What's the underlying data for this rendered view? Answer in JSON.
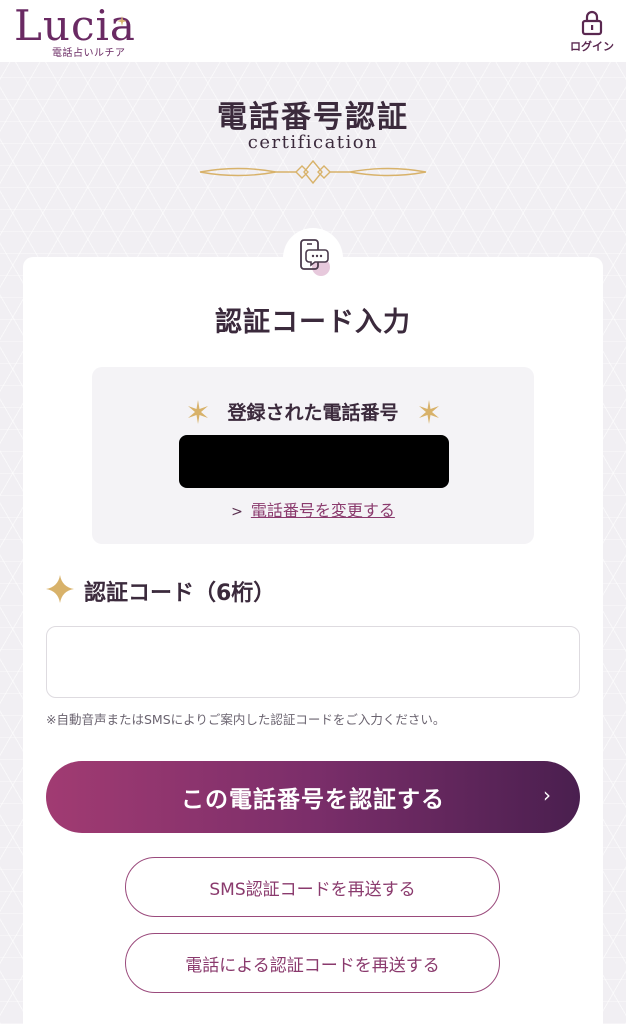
{
  "header": {
    "logo_text": "Lucia",
    "logo_sub": "電話占いルチア",
    "login_label": "ログイン"
  },
  "page": {
    "title": "電話番号認証",
    "subtitle": "certification"
  },
  "card": {
    "section_title": "認証コード入力",
    "registered_label": "登録された電話番号",
    "registered_phone": "",
    "change_link": "電話番号を変更する",
    "code_label": "認証コード（6桁）",
    "code_input_value": "",
    "code_input_placeholder": "",
    "note": "※自動音声またはSMSによりご案内した認証コードをご入力ください。",
    "verify_button": "この電話番号を認証する",
    "verify_arrow": "›",
    "resend_sms_button": "SMS認証コードを再送する",
    "resend_call_button": "電話による認証コードを再送する"
  },
  "colors": {
    "brand": "#6a2a63",
    "accent_gold": "#d8b26a",
    "button_gradient_start": "#a13b72",
    "button_gradient_end": "#4a1f4f"
  },
  "icons": {
    "login": "lock-icon",
    "badge": "phone-chat-icon",
    "sparkle": "sparkle-icon",
    "chevron": "chevron-right-icon"
  }
}
